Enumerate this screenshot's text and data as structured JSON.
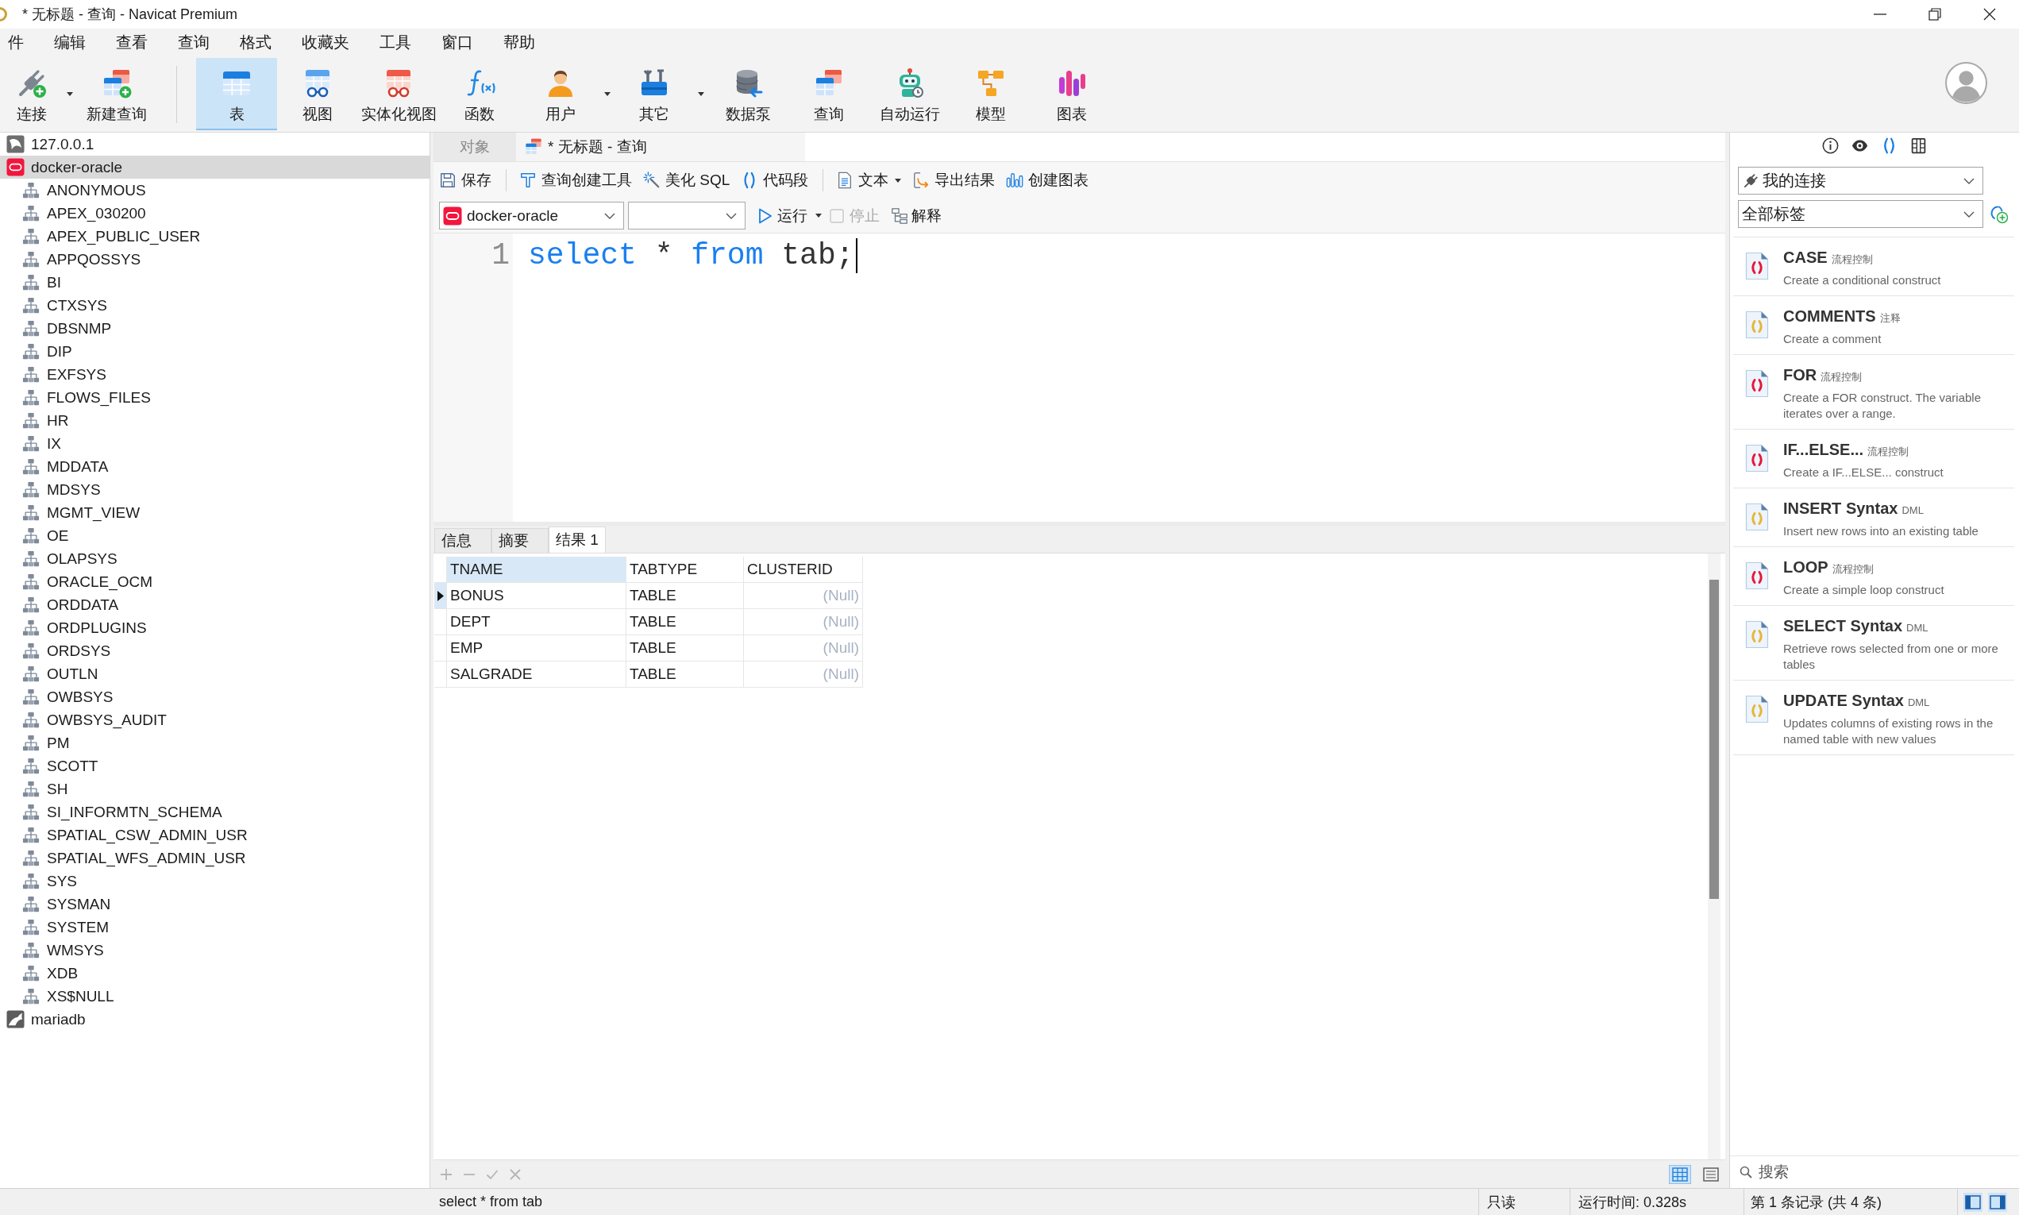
{
  "window": {
    "title": "* 无标题 - 查询 - Navicat Premium"
  },
  "menu": [
    "件",
    "编辑",
    "查看",
    "查询",
    "格式",
    "收藏夹",
    "工具",
    "窗口",
    "帮助"
  ],
  "toolbar": {
    "groups": [
      [
        {
          "kind": "connect",
          "label": "连接",
          "dropdown": true,
          "selected": false
        },
        {
          "kind": "new-query",
          "label": "新建查询",
          "dropdown": false,
          "selected": false
        }
      ],
      [
        {
          "kind": "table",
          "label": "表",
          "dropdown": false,
          "selected": true
        },
        {
          "kind": "view",
          "label": "视图",
          "dropdown": false,
          "selected": false
        },
        {
          "kind": "materialized-view",
          "label": "实体化视图",
          "dropdown": false,
          "selected": false
        },
        {
          "kind": "function",
          "label": "函数",
          "dropdown": false,
          "selected": false
        },
        {
          "kind": "user",
          "label": "用户",
          "dropdown": true,
          "selected": false
        },
        {
          "kind": "other",
          "label": "其它",
          "dropdown": true,
          "selected": false
        },
        {
          "kind": "data-pump",
          "label": "数据泵",
          "dropdown": false,
          "selected": false
        },
        {
          "kind": "query",
          "label": "查询",
          "dropdown": false,
          "selected": false
        },
        {
          "kind": "automation",
          "label": "自动运行",
          "dropdown": false,
          "selected": false
        },
        {
          "kind": "model",
          "label": "模型",
          "dropdown": false,
          "selected": false
        },
        {
          "kind": "chart",
          "label": "图表",
          "dropdown": false,
          "selected": false
        }
      ]
    ]
  },
  "object_tree": [
    {
      "kind": "mysql",
      "label": "127.0.0.1",
      "selected": false
    },
    {
      "kind": "oracle",
      "label": "docker-oracle",
      "selected": true,
      "children": [
        {
          "label": "ANONYMOUS",
          "selected": false
        },
        {
          "label": "APEX_030200",
          "selected": false
        },
        {
          "label": "APEX_PUBLIC_USER",
          "selected": false
        },
        {
          "label": "APPQOSSYS",
          "selected": false
        },
        {
          "label": "BI",
          "selected": false
        },
        {
          "label": "CTXSYS",
          "selected": false
        },
        {
          "label": "DBSNMP",
          "selected": false
        },
        {
          "label": "DIP",
          "selected": false
        },
        {
          "label": "EXFSYS",
          "selected": false
        },
        {
          "label": "FLOWS_FILES",
          "selected": false
        },
        {
          "label": "HR",
          "selected": false
        },
        {
          "label": "IX",
          "selected": false
        },
        {
          "label": "MDDATA",
          "selected": false
        },
        {
          "label": "MDSYS",
          "selected": false
        },
        {
          "label": "MGMT_VIEW",
          "selected": false
        },
        {
          "label": "OE",
          "selected": false
        },
        {
          "label": "OLAPSYS",
          "selected": false
        },
        {
          "label": "ORACLE_OCM",
          "selected": false
        },
        {
          "label": "ORDDATA",
          "selected": false
        },
        {
          "label": "ORDPLUGINS",
          "selected": false
        },
        {
          "label": "ORDSYS",
          "selected": false
        },
        {
          "label": "OUTLN",
          "selected": false
        },
        {
          "label": "OWBSYS",
          "selected": false
        },
        {
          "label": "OWBSYS_AUDIT",
          "selected": false
        },
        {
          "label": "PM",
          "selected": false
        },
        {
          "label": "SCOTT",
          "selected": false
        },
        {
          "label": "SH",
          "selected": false
        },
        {
          "label": "SI_INFORMTN_SCHEMA",
          "selected": false
        },
        {
          "label": "SPATIAL_CSW_ADMIN_USR",
          "selected": false
        },
        {
          "label": "SPATIAL_WFS_ADMIN_USR",
          "selected": false
        },
        {
          "label": "SYS",
          "selected": false
        },
        {
          "label": "SYSMAN",
          "selected": false
        },
        {
          "label": "SYSTEM",
          "selected": false
        },
        {
          "label": "WMSYS",
          "selected": false
        },
        {
          "label": "XDB",
          "selected": false
        },
        {
          "label": "XS$NULL",
          "selected": false
        }
      ]
    },
    {
      "kind": "mariadb",
      "label": "mariadb",
      "selected": false
    }
  ],
  "editor_tabs": [
    {
      "kind": "objects",
      "label": "对象",
      "selected": false
    },
    {
      "kind": "query",
      "label": "* 无标题 - 查询",
      "selected": true
    }
  ],
  "query_toolbar": {
    "groups": [
      [
        {
          "kind": "save",
          "label": "保存",
          "dropdown": false
        }
      ],
      [
        {
          "kind": "builder",
          "label": "查询创建工具",
          "dropdown": false
        },
        {
          "kind": "beautify",
          "label": "美化 SQL",
          "dropdown": false
        },
        {
          "kind": "snippet",
          "label": "代码段",
          "dropdown": false
        }
      ],
      [
        {
          "kind": "text",
          "label": "文本",
          "dropdown": true
        },
        {
          "kind": "export",
          "label": "导出结果",
          "dropdown": false
        },
        {
          "kind": "chart",
          "label": "创建图表",
          "dropdown": false
        }
      ]
    ]
  },
  "run_bar": {
    "connection": {
      "kind": "oracle",
      "label": "docker-oracle"
    },
    "run": {
      "label": "运行",
      "dropdown": true
    },
    "stop": {
      "label": "停止",
      "disabled": true
    },
    "explain": {
      "label": "解释"
    }
  },
  "editor": {
    "lines": [
      {
        "number": "1",
        "tokens": [
          {
            "kind": "keyword",
            "text": "select"
          },
          {
            "kind": "plain",
            "text": "*"
          },
          {
            "kind": "keyword",
            "text": "from"
          },
          {
            "kind": "plain",
            "text": "tab;"
          }
        ]
      }
    ]
  },
  "result_tabs": [
    {
      "label": "信息",
      "selected": false
    },
    {
      "label": "摘要",
      "selected": false
    },
    {
      "label": "结果 1",
      "selected": true
    }
  ],
  "result_grid": {
    "columns": [
      {
        "label": "TNAME",
        "selected": true
      },
      {
        "label": "TABTYPE",
        "selected": false
      },
      {
        "label": "CLUSTERID",
        "selected": false
      }
    ],
    "rows": [
      {
        "selected": true,
        "cells": [
          {
            "text": "BONUS",
            "null_value": false
          },
          {
            "text": "TABLE",
            "null_value": false
          },
          {
            "text": "(Null)",
            "null_value": true
          }
        ]
      },
      {
        "selected": false,
        "cells": [
          {
            "text": "DEPT",
            "null_value": false
          },
          {
            "text": "TABLE",
            "null_value": false
          },
          {
            "text": "(Null)",
            "null_value": true
          }
        ]
      },
      {
        "selected": false,
        "cells": [
          {
            "text": "EMP",
            "null_value": false
          },
          {
            "text": "TABLE",
            "null_value": false
          },
          {
            "text": "(Null)",
            "null_value": true
          }
        ]
      },
      {
        "selected": false,
        "cells": [
          {
            "text": "SALGRADE",
            "null_value": false
          },
          {
            "text": "TABLE",
            "null_value": false
          },
          {
            "text": "(Null)",
            "null_value": true
          }
        ]
      }
    ]
  },
  "grid_footer": {
    "record_buttons": [
      {
        "kind": "add",
        "disabled": true
      },
      {
        "kind": "remove",
        "disabled": true
      },
      {
        "kind": "apply",
        "disabled": true
      },
      {
        "kind": "cancel",
        "disabled": true
      }
    ],
    "views": [
      {
        "kind": "grid",
        "selected": true
      },
      {
        "kind": "form",
        "selected": false
      }
    ]
  },
  "snippet_panel": {
    "views": [
      {
        "kind": "info",
        "selected": false
      },
      {
        "kind": "preview",
        "selected": false
      },
      {
        "kind": "snippets",
        "selected": true
      },
      {
        "kind": "layout",
        "selected": false
      }
    ],
    "connection_filter": "我的连接",
    "tag_filter": "全部标签",
    "items": [
      {
        "title": "CASE",
        "tag": "流程控制",
        "description": "Create a conditional construct",
        "color": "#e8173a"
      },
      {
        "title": "COMMENTS",
        "tag": "注释",
        "description": "Create a comment",
        "color": "#e6b63a"
      },
      {
        "title": "FOR",
        "tag": "流程控制",
        "description": "Create a FOR construct. The variable iterates over a range.",
        "color": "#e8173a"
      },
      {
        "title": "IF...ELSE...",
        "tag": "流程控制",
        "description": "Create a IF...ELSE... construct",
        "color": "#e8173a"
      },
      {
        "title": "INSERT Syntax",
        "tag": "DML",
        "description": "Insert new rows into an existing table",
        "color": "#e6b63a"
      },
      {
        "title": "LOOP",
        "tag": "流程控制",
        "description": "Create a simple loop construct",
        "color": "#e8173a"
      },
      {
        "title": "SELECT Syntax",
        "tag": "DML",
        "description": "Retrieve rows selected from one or more tables",
        "color": "#e6b63a"
      },
      {
        "title": "UPDATE Syntax",
        "tag": "DML",
        "description": "Updates columns of existing rows in the named table with new values",
        "color": "#e6b63a"
      }
    ],
    "search": {
      "placeholder": "搜索"
    }
  },
  "status_bar": {
    "sql": "select * from tab",
    "mode": "只读",
    "elapsed": "运行时间: 0.328s",
    "record": "第 1 条记录 (共 4 条)",
    "panels": [
      {
        "kind": "left",
        "selected": true
      },
      {
        "kind": "right",
        "selected": true
      }
    ]
  }
}
